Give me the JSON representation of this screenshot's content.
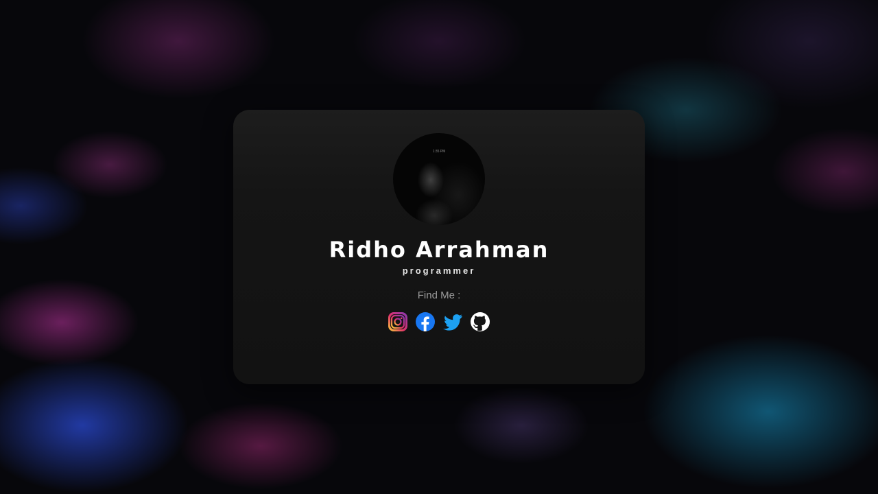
{
  "profile": {
    "name": "Ridho Arrahman",
    "role": "programmer",
    "avatar_time": "1:35 PM"
  },
  "socials": {
    "heading": "Find Me :",
    "links": [
      {
        "icon": "instagram-icon",
        "label": "Instagram",
        "color": "#e1306c"
      },
      {
        "icon": "facebook-icon",
        "label": "Facebook",
        "color": "#1877f2"
      },
      {
        "icon": "twitter-icon",
        "label": "Twitter",
        "color": "#1da1f2"
      },
      {
        "icon": "github-icon",
        "label": "GitHub",
        "color": "#ffffff"
      }
    ]
  },
  "colors": {
    "card_background": "#121212",
    "name_text": "#ffffff",
    "find_me_text": "#9a9a9a"
  }
}
